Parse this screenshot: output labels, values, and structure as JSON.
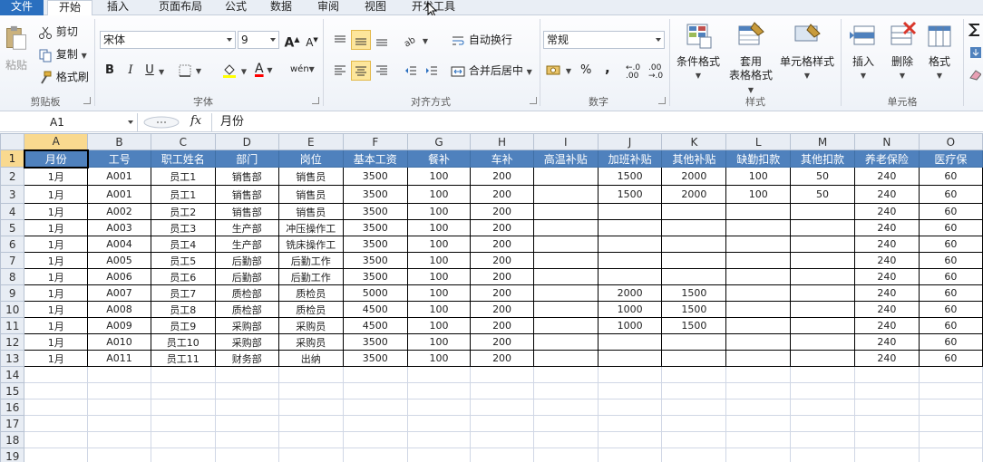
{
  "tabs": [
    {
      "id": "file",
      "label": "文件"
    },
    {
      "id": "home",
      "label": "开始"
    },
    {
      "id": "insert",
      "label": "插入"
    },
    {
      "id": "layout",
      "label": "页面布局"
    },
    {
      "id": "formula",
      "label": "公式"
    },
    {
      "id": "data",
      "label": "数据"
    },
    {
      "id": "review",
      "label": "审阅"
    },
    {
      "id": "view",
      "label": "视图"
    },
    {
      "id": "dev",
      "label": "开发工具"
    }
  ],
  "ribbon": {
    "clipboard": {
      "paste": "粘贴",
      "cut": "剪切",
      "copy": "复制",
      "format_painter": "格式刷",
      "label": "剪贴板"
    },
    "font": {
      "name": "宋体",
      "size": "9",
      "bold": "B",
      "italic": "I",
      "underline": "U",
      "grow": "A",
      "shrink": "A",
      "phonetic": "wén",
      "color_a": "A",
      "label": "字体"
    },
    "alignment": {
      "wrap": "自动换行",
      "merge": "合并后居中",
      "label": "对齐方式"
    },
    "number": {
      "format": "常规",
      "percent": "%",
      "comma": ",",
      "inc": "←.0 .00",
      "dec": ".00 →.0",
      "label": "数字"
    },
    "styles": {
      "conditional": "条件格式",
      "table_line1": "套用",
      "table_line2": "表格格式",
      "cell_styles": "单元格样式",
      "label": "样式"
    },
    "cells": {
      "insert": "插入",
      "delete": "删除",
      "format": "格式",
      "label": "单元格"
    }
  },
  "formula_bar": {
    "name_box": "A1",
    "fx": "fx",
    "content": "月份"
  },
  "columns": [
    "A",
    "B",
    "C",
    "D",
    "E",
    "F",
    "G",
    "H",
    "I",
    "J",
    "K",
    "L",
    "M",
    "N",
    "O"
  ],
  "headers": [
    "月份",
    "工号",
    "职工姓名",
    "部门",
    "岗位",
    "基本工资",
    "餐补",
    "车补",
    "高温补贴",
    "加班补贴",
    "其他补贴",
    "缺勤扣款",
    "其他扣款",
    "养老保险",
    "医疗保"
  ],
  "rows": [
    [
      "1月",
      "A001",
      "员工1",
      "销售部",
      "销售员",
      "3500",
      "100",
      "200",
      "",
      "1500",
      "2000",
      "100",
      "50",
      "240",
      "60"
    ],
    [
      "1月",
      "A001",
      "员工1",
      "销售部",
      "销售员",
      "3500",
      "100",
      "200",
      "",
      "1500",
      "2000",
      "100",
      "50",
      "240",
      "60"
    ],
    [
      "1月",
      "A002",
      "员工2",
      "销售部",
      "销售员",
      "3500",
      "100",
      "200",
      "",
      "",
      "",
      "",
      "",
      "240",
      "60"
    ],
    [
      "1月",
      "A003",
      "员工3",
      "生产部",
      "冲压操作工",
      "3500",
      "100",
      "200",
      "",
      "",
      "",
      "",
      "",
      "240",
      "60"
    ],
    [
      "1月",
      "A004",
      "员工4",
      "生产部",
      "铣床操作工",
      "3500",
      "100",
      "200",
      "",
      "",
      "",
      "",
      "",
      "240",
      "60"
    ],
    [
      "1月",
      "A005",
      "员工5",
      "后勤部",
      "后勤工作",
      "3500",
      "100",
      "200",
      "",
      "",
      "",
      "",
      "",
      "240",
      "60"
    ],
    [
      "1月",
      "A006",
      "员工6",
      "后勤部",
      "后勤工作",
      "3500",
      "100",
      "200",
      "",
      "",
      "",
      "",
      "",
      "240",
      "60"
    ],
    [
      "1月",
      "A007",
      "员工7",
      "质检部",
      "质检员",
      "5000",
      "100",
      "200",
      "",
      "2000",
      "1500",
      "",
      "",
      "240",
      "60"
    ],
    [
      "1月",
      "A008",
      "员工8",
      "质检部",
      "质检员",
      "4500",
      "100",
      "200",
      "",
      "1000",
      "1500",
      "",
      "",
      "240",
      "60"
    ],
    [
      "1月",
      "A009",
      "员工9",
      "采购部",
      "采购员",
      "4500",
      "100",
      "200",
      "",
      "1000",
      "1500",
      "",
      "",
      "240",
      "60"
    ],
    [
      "1月",
      "A010",
      "员工10",
      "采购部",
      "采购员",
      "3500",
      "100",
      "200",
      "",
      "",
      "",
      "",
      "",
      "240",
      "60"
    ],
    [
      "1月",
      "A011",
      "员工11",
      "财务部",
      "出纳",
      "3500",
      "100",
      "200",
      "",
      "",
      "",
      "",
      "",
      "240",
      "60"
    ]
  ],
  "empty_rows": [
    "14",
    "15",
    "16",
    "17",
    "18",
    "19"
  ]
}
